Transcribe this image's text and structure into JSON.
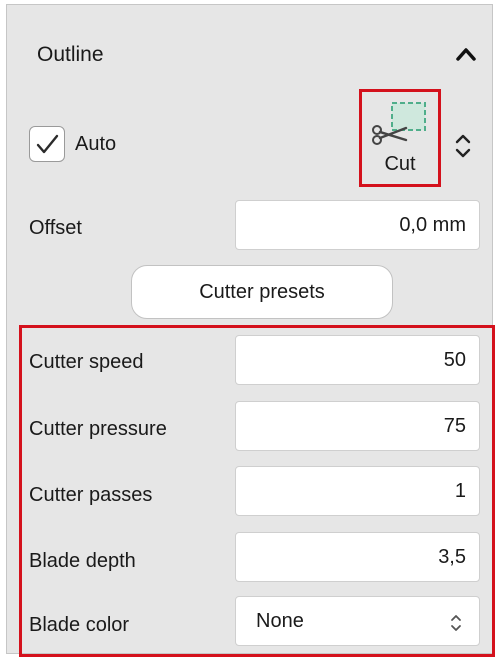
{
  "outline": {
    "title": "Outline",
    "collapse_icon": "chevron-up-icon",
    "auto_label": "Auto",
    "auto_checked": true,
    "cut_mode": {
      "icon": "scissors-cut-icon",
      "label": "Cut"
    },
    "offset": {
      "label": "Offset",
      "value": "0,0 mm"
    },
    "presets_button": "Cutter presets",
    "settings": [
      {
        "label": "Cutter speed",
        "value": "50"
      },
      {
        "label": "Cutter pressure",
        "value": "75"
      },
      {
        "label": "Cutter passes",
        "value": "1"
      },
      {
        "label": "Blade depth",
        "value": "3,5"
      }
    ],
    "blade_color": {
      "label": "Blade color",
      "value": "None"
    }
  },
  "colors": {
    "highlight": "#d4111c",
    "panel_bg": "#e6e6e6",
    "guide_green": "#4fae8a"
  }
}
